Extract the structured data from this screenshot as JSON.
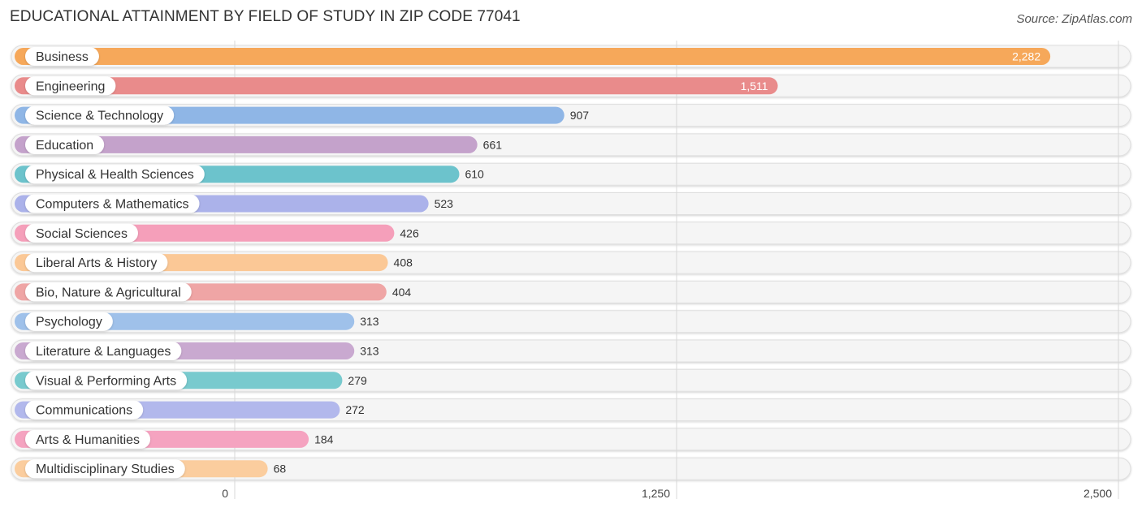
{
  "header": {
    "title": "EDUCATIONAL ATTAINMENT BY FIELD OF STUDY IN ZIP CODE 77041",
    "source": "Source: ZipAtlas.com"
  },
  "chart_data": {
    "type": "bar",
    "orientation": "horizontal",
    "title": "EDUCATIONAL ATTAINMENT BY FIELD OF STUDY IN ZIP CODE 77041",
    "source": "Source: ZipAtlas.com",
    "xlabel": "",
    "ylabel": "",
    "xlim": [
      0,
      2500
    ],
    "xticks": [
      0,
      1250,
      2500
    ],
    "xtick_labels": [
      "0",
      "1,250",
      "2,500"
    ],
    "grid": true,
    "legend": "none",
    "categories": [
      "Business",
      "Engineering",
      "Science & Technology",
      "Education",
      "Physical & Health Sciences",
      "Computers & Mathematics",
      "Social Sciences",
      "Liberal Arts & History",
      "Bio, Nature & Agricultural",
      "Psychology",
      "Literature & Languages",
      "Visual & Performing Arts",
      "Communications",
      "Arts & Humanities",
      "Multidisciplinary Studies"
    ],
    "values": [
      2282,
      1511,
      907,
      661,
      610,
      523,
      426,
      408,
      404,
      313,
      313,
      279,
      272,
      184,
      68
    ],
    "value_labels": [
      "2,282",
      "1,511",
      "907",
      "661",
      "610",
      "523",
      "426",
      "408",
      "404",
      "313",
      "313",
      "279",
      "272",
      "184",
      "68"
    ],
    "colors": [
      "#f6a85a",
      "#e98b8b",
      "#8fb6e6",
      "#c4a2cb",
      "#6cc3cc",
      "#abb2ea",
      "#f59fba",
      "#fbc896",
      "#efa5a5",
      "#9fc1ea",
      "#c9a9d0",
      "#78cace",
      "#b2b8ec",
      "#f5a3c0",
      "#fbcd9e"
    ]
  }
}
